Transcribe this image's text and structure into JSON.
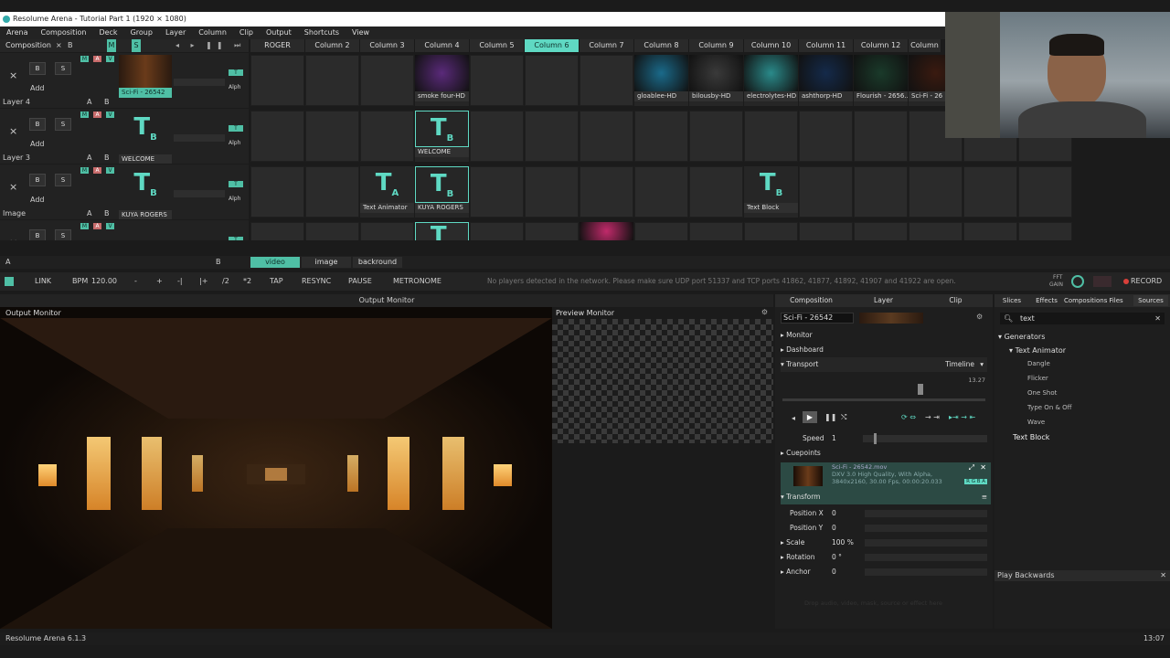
{
  "window": {
    "title": "Resolume Arena - Tutorial Part 1 (1920 × 1080)"
  },
  "menu": [
    "Arena",
    "Composition",
    "Deck",
    "Group",
    "Layer",
    "Column",
    "Clip",
    "Output",
    "Shortcuts",
    "View"
  ],
  "composition_header": {
    "label": "Composition",
    "x": "×",
    "b": "B",
    "m": "M",
    "s": "S"
  },
  "columns": [
    "ROGER",
    "Column 2",
    "Column 3",
    "Column 4",
    "Column 5",
    "Column 6",
    "Column 7",
    "Column 8",
    "Column 9",
    "Column 10",
    "Column 11",
    "Column 12",
    "Column"
  ],
  "active_column_index": 5,
  "layers": [
    {
      "name": "Layer 4",
      "clip": "Sci-Fi - 26542",
      "add": "Add"
    },
    {
      "name": "Layer 3",
      "clip": "WELCOME",
      "add": "Add"
    },
    {
      "name": "Image",
      "clip": "KUYA ROGERS",
      "add": "Add"
    },
    {
      "name": "",
      "clip": "",
      "add": "Add"
    }
  ],
  "layer_buttons": {
    "x": "×",
    "b": "B",
    "s": "S",
    "a": "A",
    "bb": "B",
    "m": "M",
    "t": "T",
    "alph": "Alph"
  },
  "row1_clips": [
    {
      "col": 3,
      "label": "smoke four-HD"
    },
    {
      "col": 7,
      "label": "gloablee-HD"
    },
    {
      "col": 8,
      "label": "bilousby-HD"
    },
    {
      "col": 9,
      "label": "electrolytes-HD"
    },
    {
      "col": 10,
      "label": "ashthorp-HD"
    },
    {
      "col": 11,
      "label": "Flourish - 2656..."
    },
    {
      "col": 12,
      "label": "Sci-Fi - 26"
    }
  ],
  "row2_clips": [
    {
      "col": 3,
      "label": "WELCOME"
    }
  ],
  "row3_clips": [
    {
      "col": 2,
      "label": "Text Animator"
    },
    {
      "col": 3,
      "label": "KUYA ROGERS"
    },
    {
      "col": 9,
      "label": "Text Block"
    }
  ],
  "deck_tabs": [
    "video",
    "image",
    "backround"
  ],
  "deck_letters": {
    "a": "A",
    "b": "B"
  },
  "transport_bar": {
    "link": "LINK",
    "bpm_label": "BPM",
    "bpm_value": "120.00",
    "minus": "-",
    "plus": "+",
    "nudge_minus": "-|",
    "nudge_plus": "|+",
    "half": "/2",
    "double": "*2",
    "tap": "TAP",
    "resync": "RESYNC",
    "pause": "PAUSE",
    "metronome": "METRONOME",
    "network_msg": "No players detected in the network. Please make sure UDP port 51337 and TCP ports 41862, 41877, 41892, 41907 and 41922 are open.",
    "fft": "FFT",
    "gain": "GAIN",
    "record": "RECORD"
  },
  "output_monitor": {
    "center_label": "Output Monitor",
    "label": "Output Monitor"
  },
  "preview_monitor": {
    "label": "Preview Monitor"
  },
  "clip_panel": {
    "tabs": [
      "Composition",
      "Layer",
      "Clip"
    ],
    "clip_name": "Sci-Fi - 26542",
    "sections": {
      "monitor": "Monitor",
      "dashboard": "Dashboard",
      "transport": "Transport",
      "cuepoints": "Cuepoints",
      "transform": "Transform"
    },
    "timeline": "Timeline",
    "time": "13.27",
    "speed_label": "Speed",
    "speed_value": "1",
    "file_name": "Sci-Fi - 26542.mov",
    "file_info1": "DXV 3.0 High Quality, With Alpha,",
    "file_info2": "3840x2160, 30.00 Fps, 00:00:20.033",
    "rgba": "R G B A",
    "props": [
      {
        "label": "Position X",
        "value": "0"
      },
      {
        "label": "Position Y",
        "value": "0"
      },
      {
        "label": "Scale",
        "value": "100 %"
      },
      {
        "label": "Rotation",
        "value": "0 °"
      },
      {
        "label": "Anchor",
        "value": "0"
      }
    ],
    "drop_hint": "Drop audio, video, mask, source or effect here"
  },
  "sources_panel": {
    "tabs": [
      "Slices",
      "Effects",
      "Compositions",
      "Files",
      "Sources"
    ],
    "search_value": "text",
    "tree_root": "Generators",
    "tree_group": "Text Animator",
    "tree_items": [
      "Dangle",
      "Flicker",
      "One Shot",
      "Type On & Off",
      "Wave"
    ],
    "selected_item": "Text Block",
    "bottom_label": "Play Backwards"
  },
  "status": {
    "version": "Resolume Arena 6.1.3",
    "time": "13:07"
  },
  "colors": {
    "accent": "#5fd9c3",
    "record": "#d9403a",
    "background": "#1b1b1b"
  }
}
